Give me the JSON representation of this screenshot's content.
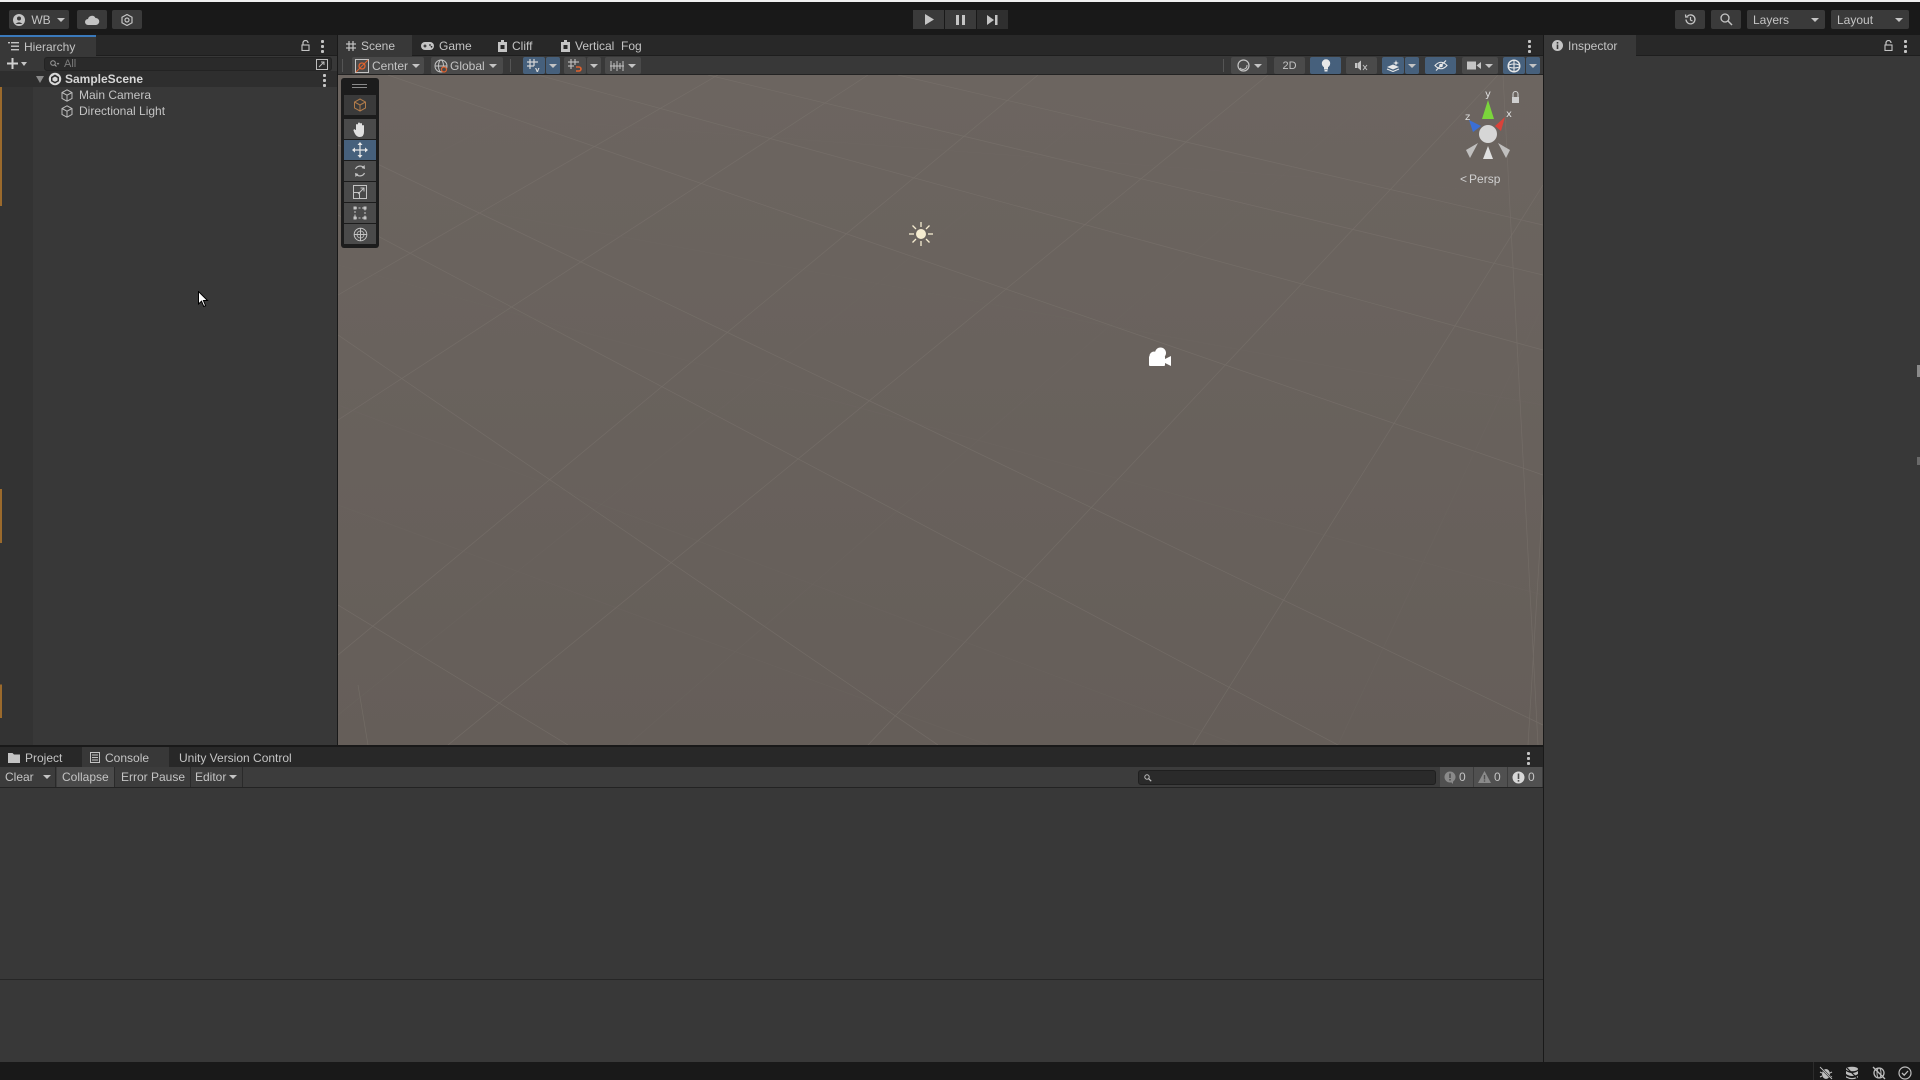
{
  "topbar": {
    "account_label": "WB",
    "account_icon": "user-circle-icon",
    "cloud_icon": "cloud-icon",
    "package_icon": "hexagon-settings-icon",
    "play_icon": "play-icon",
    "pause_icon": "pause-icon",
    "step_icon": "step-icon",
    "history_icon": "history-icon",
    "search_icon": "search-icon",
    "layers_label": "Layers",
    "layout_label": "Layout"
  },
  "hierarchy": {
    "tab_label": "Hierarchy",
    "search_placeholder": "All",
    "scene_name": "SampleScene",
    "items": [
      {
        "label": "Main Camera",
        "icon": "gameobject-cube-icon"
      },
      {
        "label": "Directional Light",
        "icon": "gameobject-cube-icon"
      }
    ]
  },
  "scene_tabs": [
    {
      "label": "Scene",
      "icon": "grid-hash-icon",
      "active": true
    },
    {
      "label": "Game",
      "icon": "gamepad-icon",
      "active": false
    },
    {
      "label": "Cliff",
      "icon": "script-asset-icon",
      "active": false
    },
    {
      "label": "Vertical  Fog",
      "icon": "script-asset-icon",
      "active": false
    }
  ],
  "scene_toolbar": {
    "pivot_label": "Center",
    "space_label": "Global",
    "mode_2d_label": "2D"
  },
  "scene_view": {
    "projection_label": "Persp",
    "gizmo_axes": {
      "x": "x",
      "y": "y",
      "z": "z"
    },
    "colors": {
      "x": "#d9423a",
      "y": "#7bd53c",
      "z": "#3b6fd6",
      "ground": "#655e59"
    },
    "tools": [
      {
        "name": "view-tool",
        "active": false
      },
      {
        "name": "hand-tool",
        "active": false
      },
      {
        "name": "move-tool",
        "active": true
      },
      {
        "name": "rotate-tool",
        "active": false
      },
      {
        "name": "scale-tool",
        "active": false
      },
      {
        "name": "rect-tool",
        "active": false
      },
      {
        "name": "transform-tool",
        "active": false
      }
    ]
  },
  "console": {
    "tabs": [
      {
        "label": "Project",
        "icon": "folder-icon",
        "active": false
      },
      {
        "label": "Console",
        "icon": "console-list-icon",
        "active": true
      },
      {
        "label": "Unity Version Control",
        "icon": "",
        "active": false
      }
    ],
    "clear_label": "Clear",
    "collapse_label": "Collapse",
    "error_pause_label": "Error Pause",
    "editor_label": "Editor",
    "search_placeholder": "",
    "log_count": "0",
    "warning_count": "0",
    "error_count": "0"
  },
  "inspector": {
    "tab_label": "Inspector"
  },
  "statusbar": {
    "icons": [
      "debug-off-icon",
      "cache-server-icon",
      "network-off-icon",
      "check-circle-icon"
    ]
  }
}
